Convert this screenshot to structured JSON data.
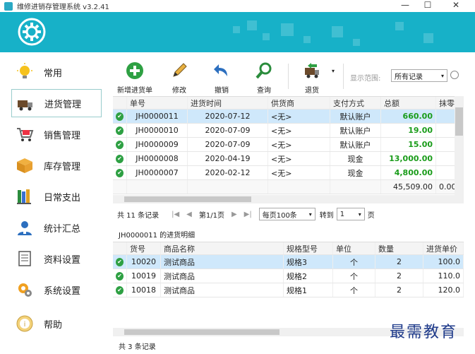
{
  "window": {
    "title": "维修进销存管理系统   v3.2.41",
    "min": "—",
    "max": "☐",
    "close": "✕"
  },
  "sidebar": {
    "items": [
      {
        "label": "常用",
        "icon": "bulb-icon"
      },
      {
        "label": "进货管理",
        "icon": "truck-icon",
        "active": true
      },
      {
        "label": "销售管理",
        "icon": "cart-icon"
      },
      {
        "label": "库存管理",
        "icon": "box-icon"
      },
      {
        "label": "日常支出",
        "icon": "books-icon"
      },
      {
        "label": "统计汇总",
        "icon": "user-stats-icon"
      },
      {
        "label": "资料设置",
        "icon": "document-icon"
      },
      {
        "label": "系统设置",
        "icon": "settings-icon"
      },
      {
        "label": "帮助",
        "icon": "help-icon"
      }
    ]
  },
  "toolbar": {
    "new": "新增进货单",
    "edit": "修改",
    "revoke": "撤销",
    "query": "查询",
    "return": "退货",
    "range_label": "显示范围:",
    "range_value": "所有记录"
  },
  "orders": {
    "headers": [
      "单号",
      "进货时间",
      "供货商",
      "支付方式",
      "总额",
      "抹零"
    ],
    "rows": [
      {
        "no": "JH0000011",
        "date": "2020-07-12",
        "supplier": "<无>",
        "pay": "默认账户",
        "total": "660.00"
      },
      {
        "no": "JH0000010",
        "date": "2020-07-09",
        "supplier": "<无>",
        "pay": "默认账户",
        "total": "19.00"
      },
      {
        "no": "JH0000009",
        "date": "2020-07-09",
        "supplier": "<无>",
        "pay": "默认账户",
        "total": "15.00"
      },
      {
        "no": "JH0000008",
        "date": "2020-04-19",
        "supplier": "<无>",
        "pay": "现金",
        "total": "13,000.00"
      },
      {
        "no": "JH0000007",
        "date": "2020-02-12",
        "supplier": "<无>",
        "pay": "现金",
        "total": "4,800.00"
      }
    ],
    "sum_total": "45,509.00",
    "sum_discount": "0.00"
  },
  "pager": {
    "count": "共 11 条记录",
    "page": "第1/1页",
    "per_page": "每页100条",
    "goto": "转到",
    "goto_value": "1",
    "page_unit": "页"
  },
  "detail": {
    "title": "JH0000011 的进货明细",
    "headers": [
      "货号",
      "商品名称",
      "规格型号",
      "单位",
      "数量",
      "进货单价"
    ],
    "rows": [
      {
        "code": "10020",
        "name": "测试商品",
        "spec": "规格3",
        "unit": "个",
        "qty": "2",
        "price": "100.0"
      },
      {
        "code": "10019",
        "name": "测试商品",
        "spec": "规格2",
        "unit": "个",
        "qty": "2",
        "price": "110.0"
      },
      {
        "code": "10018",
        "name": "测试商品",
        "spec": "规格1",
        "unit": "个",
        "qty": "2",
        "price": "120.0"
      }
    ],
    "count": "共 3 条记录"
  },
  "watermark": "最需教育",
  "colors": {
    "banner": "#17b1c8",
    "selected_row": "#cfe8fb",
    "amount": "#1a9c1a"
  }
}
